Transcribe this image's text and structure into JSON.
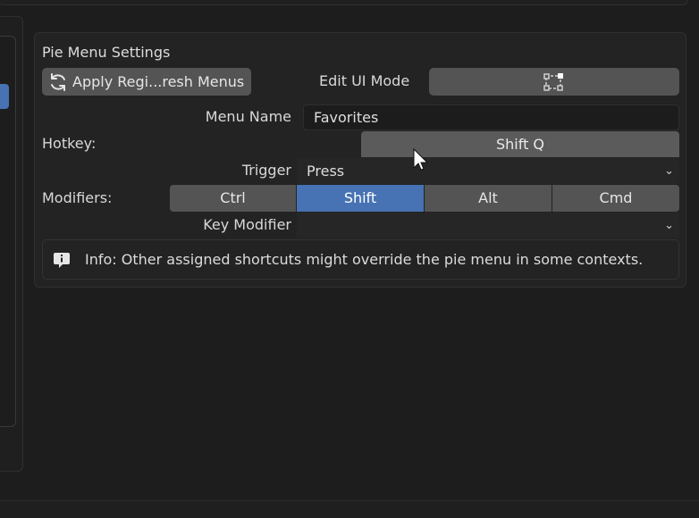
{
  "panel": {
    "title": "Pie Menu Settings",
    "apply_button": "Apply Regi...resh Menus",
    "edit_ui_mode_label": "Edit UI Mode",
    "menu_name_label": "Menu Name",
    "menu_name_value": "Favorites",
    "hotkey_label": "Hotkey:",
    "hotkey_value": "Shift Q",
    "trigger_label": "Trigger",
    "trigger_value": "Press",
    "modifiers_label": "Modifiers:",
    "modifiers": [
      {
        "label": "Ctrl",
        "active": false
      },
      {
        "label": "Shift",
        "active": true
      },
      {
        "label": "Alt",
        "active": false
      },
      {
        "label": "Cmd",
        "active": false
      }
    ],
    "key_modifier_label": "Key Modifier",
    "key_modifier_value": "",
    "info_text": "Info: Other assigned shortcuts might override the pie menu in some contexts."
  },
  "icons": {
    "refresh": "refresh-icon",
    "edit_mode": "node-edit-icon",
    "info": "info-icon",
    "dropdown": "chevron-down-icon",
    "cursor": "mouse-cursor-icon"
  },
  "colors": {
    "accent": "#4772b3",
    "button": "#545454",
    "background": "#1d1d1d",
    "panel": "#232323"
  }
}
